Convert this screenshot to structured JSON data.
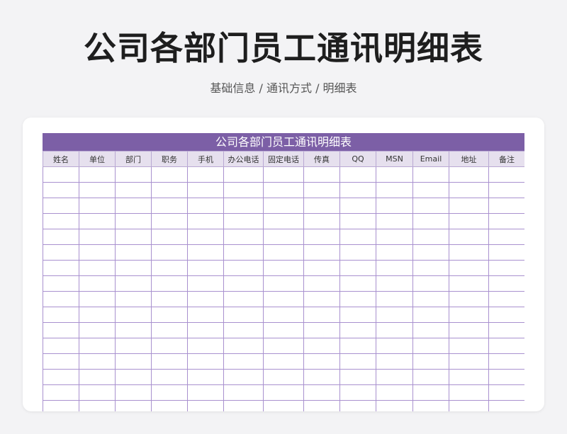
{
  "page": {
    "title": "公司各部门员工通讯明细表",
    "subtitle": "基础信息 / 通讯方式 / 明细表"
  },
  "sheet": {
    "title": "公司各部门员工通讯明细表",
    "columns": [
      "姓名",
      "单位",
      "部门",
      "职务",
      "手机",
      "办公电话",
      "固定电话",
      "传真",
      "QQ",
      "MSN",
      "Email",
      "地址",
      "备注"
    ],
    "empty_row_count": 16
  },
  "colors": {
    "accent": "#7c5fa6",
    "header_bg": "#e6e0ee",
    "grid_line": "#a991cf"
  }
}
